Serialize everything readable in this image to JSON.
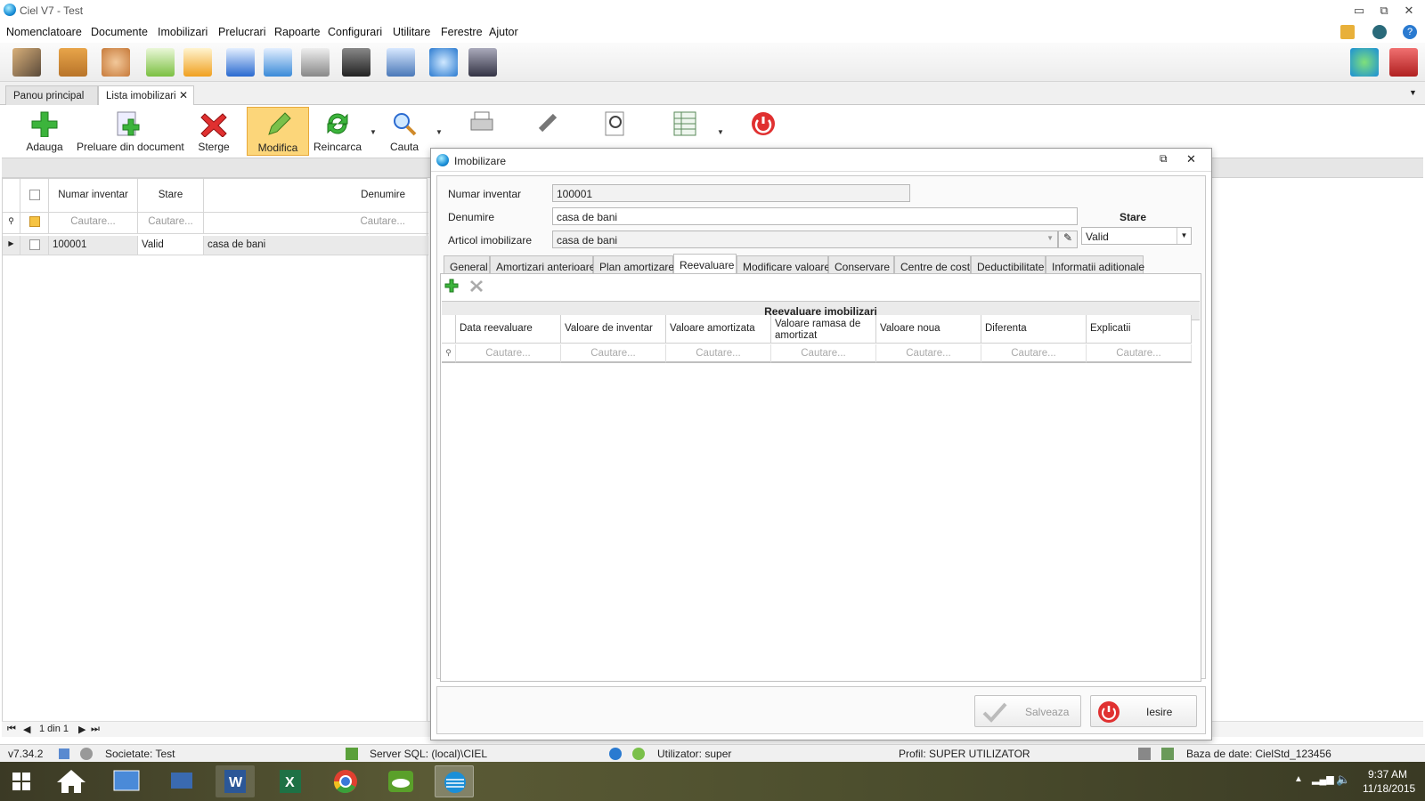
{
  "window": {
    "title": "Ciel V7 - Test"
  },
  "menu": [
    "Nomenclatoare",
    "Documente",
    "Imobilizari",
    "Prelucrari",
    "Rapoarte",
    "Configurari",
    "Utilitare",
    "Ferestre",
    "Ajutor"
  ],
  "tabs": {
    "home": "Panou principal",
    "list": "Lista imobilizari",
    "close": "✕"
  },
  "ribbon": {
    "add": "Adauga",
    "from_doc": "Preluare din document",
    "delete": "Sterge",
    "edit": "Modifica",
    "reload": "Reincarca",
    "search": "Cauta"
  },
  "list": {
    "headers": {
      "inventory": "Numar inventar",
      "state": "Stare",
      "name": "Denumire"
    },
    "search_placeholder": "Cautare...",
    "rows": [
      {
        "inventory": "100001",
        "state": "Valid",
        "name": "casa de bani"
      }
    ],
    "pager": "1 din 1"
  },
  "dialog": {
    "title": "Imobilizare",
    "fields": {
      "inventory_label": "Numar inventar",
      "inventory_value": "100001",
      "name_label": "Denumire",
      "name_value": "casa de bani",
      "article_label": "Articol imobilizare",
      "article_value": "casa de bani",
      "state_label": "Stare",
      "state_value": "Valid"
    },
    "tabs": [
      "General",
      "Amortizari anterioare",
      "Plan amortizare",
      "Reevaluare",
      "Modificare valoare",
      "Conservare",
      "Centre de cost",
      "Deductibilitate",
      "Informatii aditionale"
    ],
    "selected_tab": "Reevaluare",
    "grid_title": "Reevaluare imobilizari",
    "columns": [
      "Data reevaluare",
      "Valoare de inventar",
      "Valoare amortizata",
      "Valoare ramasa de amortizat",
      "Valoare noua",
      "Diferenta",
      "Explicatii"
    ],
    "search_placeholder": "Cautare...",
    "save": "Salveaza",
    "exit": "Iesire"
  },
  "status": {
    "version": "v7.34.2",
    "company": "Societate: Test",
    "server": "Server SQL: (local)\\CIEL",
    "user": "Utilizator: super",
    "profile": "Profil: SUPER UTILIZATOR",
    "database": "Baza de date: CielStd_123456"
  },
  "taskbar": {
    "time": "9:37 AM",
    "date": "11/18/2015"
  },
  "colors": {
    "active_button": "#fcd67a",
    "accent": "#1a8fd8"
  }
}
